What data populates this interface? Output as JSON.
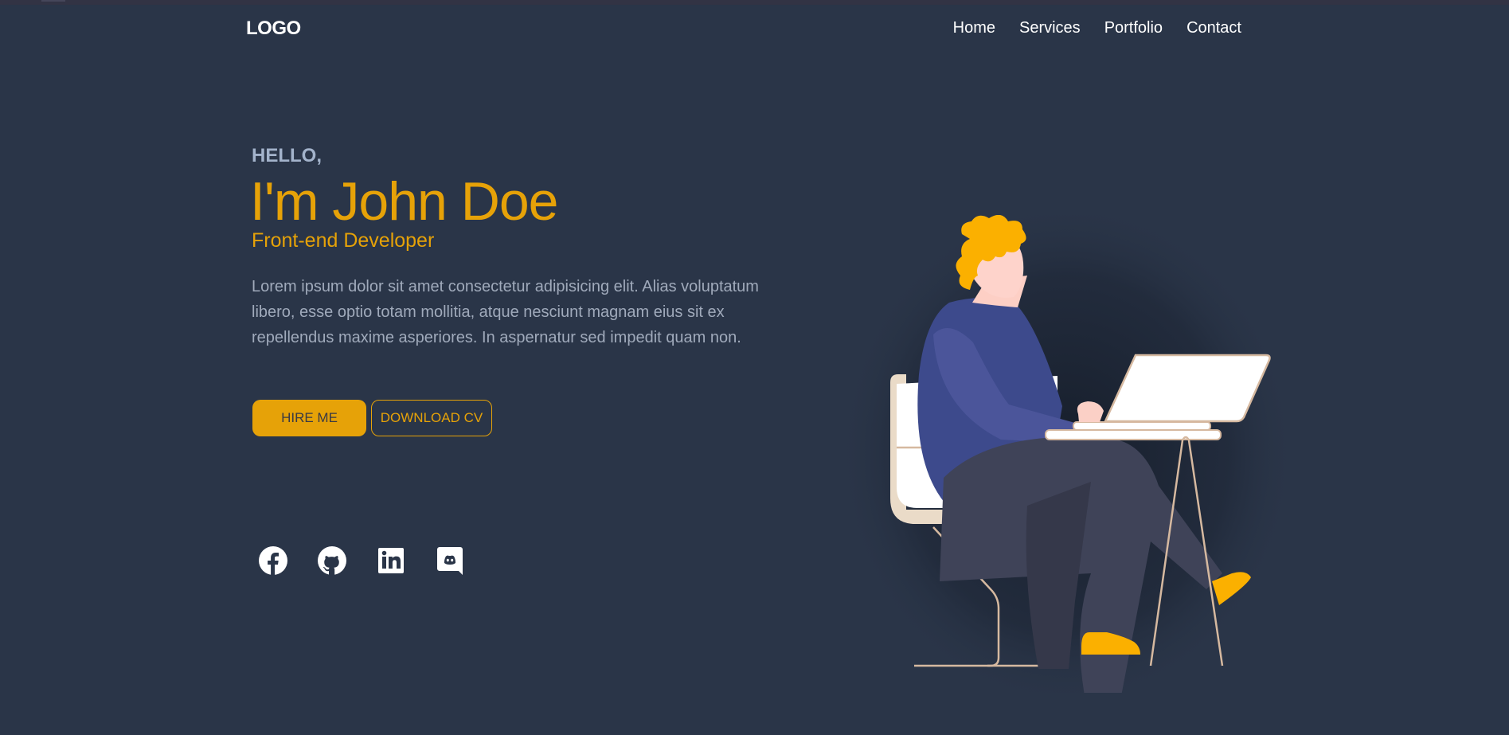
{
  "header": {
    "logo": "LOGO",
    "nav": [
      {
        "label": "Home"
      },
      {
        "label": "Services"
      },
      {
        "label": "Portfolio"
      },
      {
        "label": "Contact"
      }
    ]
  },
  "hero": {
    "greeting": "HELLO,",
    "name": "I'm John Doe",
    "role": "Front-end Developer",
    "description": "Lorem ipsum dolor sit amet consectetur adipisicing elit. Alias voluptatum libero, esse optio totam mollitia, atque nesciunt magnam eius sit ex repellendus maxime asperiores. In aspernatur sed impedit quam non.",
    "buttons": {
      "hire": "HIRE ME",
      "download": "DOWNLOAD CV"
    }
  },
  "social": [
    {
      "icon": "facebook-icon"
    },
    {
      "icon": "github-icon"
    },
    {
      "icon": "linkedin-icon"
    },
    {
      "icon": "discord-icon"
    }
  ],
  "colors": {
    "background": "#2a3548",
    "accent": "#e6a208",
    "text_muted": "#a0aabb"
  }
}
